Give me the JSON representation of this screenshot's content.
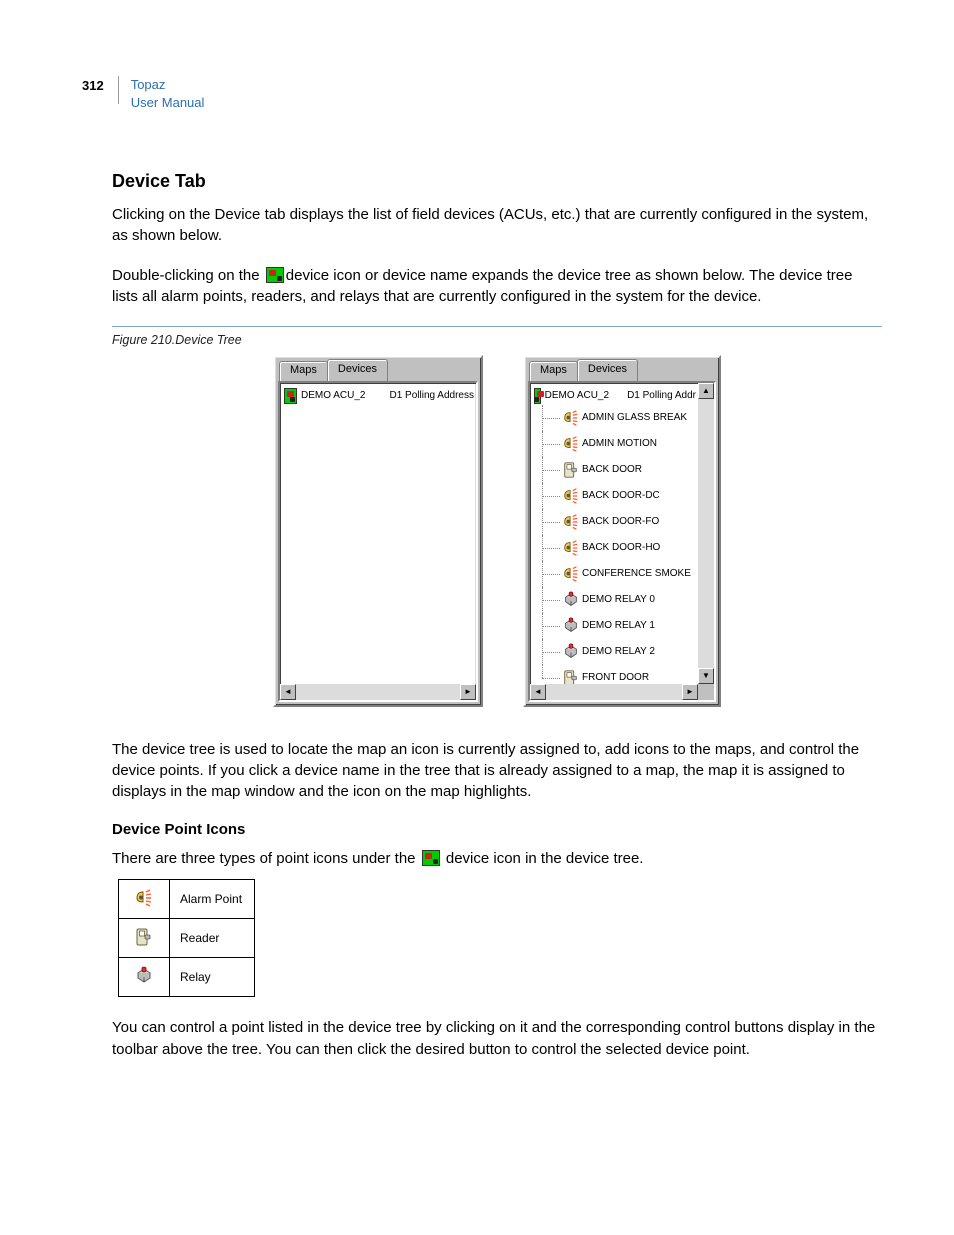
{
  "header": {
    "page_number": "312",
    "product": "Topaz",
    "subtitle": "User Manual"
  },
  "section_heading": "Device Tab",
  "paragraph_1": "Clicking on the Device tab displays the list of field devices (ACUs, etc.) that are currently configured in the system, as shown below.",
  "paragraph_2a": "Double-clicking on the ",
  "paragraph_2b": "device icon or device name expands the device tree as shown below. The device tree lists all alarm points, readers, and relays that are currently configured in the system for the device.",
  "figure_caption": "Figure 210.Device Tree",
  "tabs": {
    "maps": "Maps",
    "devices": "Devices"
  },
  "device_root": {
    "name": "DEMO ACU_2",
    "address_full": "D1 Polling Address",
    "address_trunc": "D1 Polling Addr"
  },
  "tree_children": [
    {
      "label": "ADMIN GLASS BREAK",
      "type": "alarm"
    },
    {
      "label": "ADMIN MOTION",
      "type": "alarm"
    },
    {
      "label": "BACK DOOR",
      "type": "reader"
    },
    {
      "label": "BACK DOOR-DC",
      "type": "alarm"
    },
    {
      "label": "BACK DOOR-FO",
      "type": "alarm"
    },
    {
      "label": "BACK DOOR-HO",
      "type": "alarm"
    },
    {
      "label": "CONFERENCE SMOKE",
      "type": "alarm"
    },
    {
      "label": "DEMO RELAY 0",
      "type": "relay"
    },
    {
      "label": "DEMO RELAY 1",
      "type": "relay"
    },
    {
      "label": "DEMO RELAY 2",
      "type": "relay"
    },
    {
      "label": "FRONT DOOR",
      "type": "reader"
    }
  ],
  "paragraph_3": "The device tree is used to locate the map an icon is currently assigned to, add icons to the maps, and control the device points. If you click a device name in the tree that is already assigned to a map, the map it is assigned to displays in the map window and the icon on the map highlights.",
  "sub_heading": "Device Point Icons",
  "paragraph_4a": "There are three types of point icons under the ",
  "paragraph_4b": " device icon in the device tree.",
  "icon_legend": [
    {
      "type": "alarm",
      "label": "Alarm Point"
    },
    {
      "type": "reader",
      "label": "Reader"
    },
    {
      "type": "relay",
      "label": "Relay"
    }
  ],
  "paragraph_5": "You can control a point listed in the device tree by clicking on it and the corresponding control buttons display in the toolbar above the tree. You can then click the desired button to control the selected device point."
}
